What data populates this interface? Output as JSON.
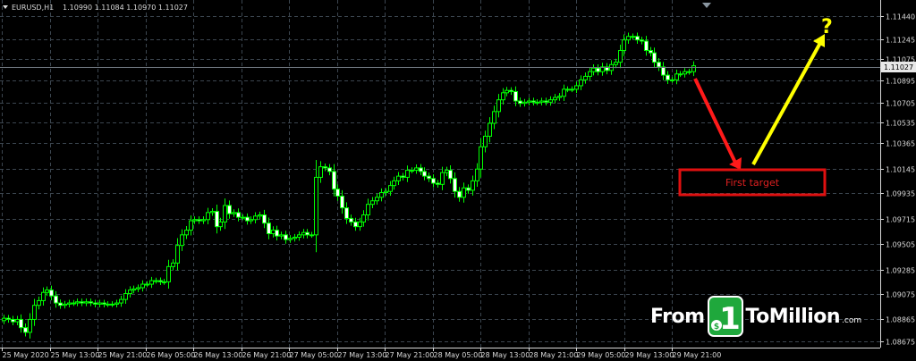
{
  "chart_data": {
    "type": "candlestick",
    "title": "EURUSD,H1",
    "ohlc_header": "1.10990 1.11084 1.10970 1.11027",
    "current_price": "1.11027",
    "ylim": [
      1.0862,
      1.1158
    ],
    "y_ticks": [
      "1.11440",
      "1.11245",
      "1.11075",
      "1.10895",
      "1.10705",
      "1.10535",
      "1.10365",
      "1.10145",
      "1.09935",
      "1.09715",
      "1.09505",
      "1.09285",
      "1.09075",
      "1.08865",
      "1.08675"
    ],
    "x_ticks": [
      "25 May 2020",
      "25 May 13:00",
      "25 May 21:00",
      "26 May 05:00",
      "26 May 13:00",
      "26 May 21:00",
      "27 May 05:00",
      "27 May 13:00",
      "27 May 21:00",
      "28 May 05:00",
      "28 May 13:00",
      "28 May 21:00",
      "29 May 05:00",
      "29 May 13:00",
      "29 May 21:00"
    ],
    "bull_color": "#00ff00",
    "bear_color": "#ffffff",
    "grid": true,
    "closes": [
      1.0887,
      1.0886,
      1.0884,
      1.0886,
      1.0879,
      1.0875,
      1.0886,
      1.0898,
      1.0902,
      1.0909,
      1.0911,
      1.0906,
      1.09,
      1.0898,
      1.0899,
      1.09,
      1.09,
      1.0901,
      1.09,
      1.0901,
      1.09,
      1.0899,
      1.09,
      1.0899,
      1.0899,
      1.0899,
      1.09,
      1.0903,
      1.0908,
      1.0911,
      1.0912,
      1.0913,
      1.0916,
      1.0916,
      1.0919,
      1.0919,
      1.0918,
      1.0918,
      1.0931,
      1.0934,
      1.0949,
      1.0958,
      1.0962,
      1.097,
      1.0971,
      1.097,
      1.0971,
      1.0977,
      1.0978,
      1.0965,
      1.0969,
      1.0983,
      1.0976,
      1.0977,
      1.0973,
      1.0973,
      1.097,
      1.0971,
      1.0974,
      1.0975,
      1.0968,
      1.0959,
      1.0962,
      1.0957,
      1.0958,
      1.0954,
      1.0955,
      1.0956,
      1.0958,
      1.096,
      1.0958,
      1.0958,
      1.1007,
      1.1016,
      1.1015,
      1.1012,
      1.0997,
      1.0991,
      1.0981,
      1.0972,
      1.0969,
      1.0965,
      1.0969,
      1.0975,
      1.0984,
      1.0987,
      1.099,
      1.0994,
      1.0995,
      1.1,
      1.1004,
      1.1008,
      1.1007,
      1.1013,
      1.1013,
      1.1015,
      1.1012,
      1.1008,
      1.1006,
      1.1002,
      1.1001,
      1.1011,
      1.1013,
      1.1006,
      1.0995,
      1.099,
      1.0998,
      1.0996,
      1.1004,
      1.1014,
      1.1033,
      1.1042,
      1.1053,
      1.1063,
      1.1073,
      1.1079,
      1.1081,
      1.108,
      1.1072,
      1.107,
      1.1071,
      1.1072,
      1.1071,
      1.1071,
      1.1072,
      1.1071,
      1.1073,
      1.1075,
      1.1076,
      1.1082,
      1.1082,
      1.1082,
      1.1085,
      1.109,
      1.1093,
      1.1097,
      1.11,
      1.1097,
      1.1101,
      1.1098,
      1.1103,
      1.1105,
      1.1115,
      1.1124,
      1.1127,
      1.1127,
      1.1124,
      1.1123,
      1.1115,
      1.1113,
      1.1105,
      1.1101,
      1.1094,
      1.109,
      1.109,
      1.1095,
      1.1095,
      1.1097,
      1.1097,
      1.1102
    ],
    "annotations": {
      "target_label": "First target",
      "question_mark": "?",
      "down_arrow_color": "#ff1a1a",
      "up_arrow_color": "#ffff00",
      "target_box_color": "#e01010"
    }
  },
  "logo": {
    "word1": "From",
    "digit": "1",
    "word2": "ToMillion",
    "suffix": ".com",
    "badge_color": "#1fa83c"
  }
}
